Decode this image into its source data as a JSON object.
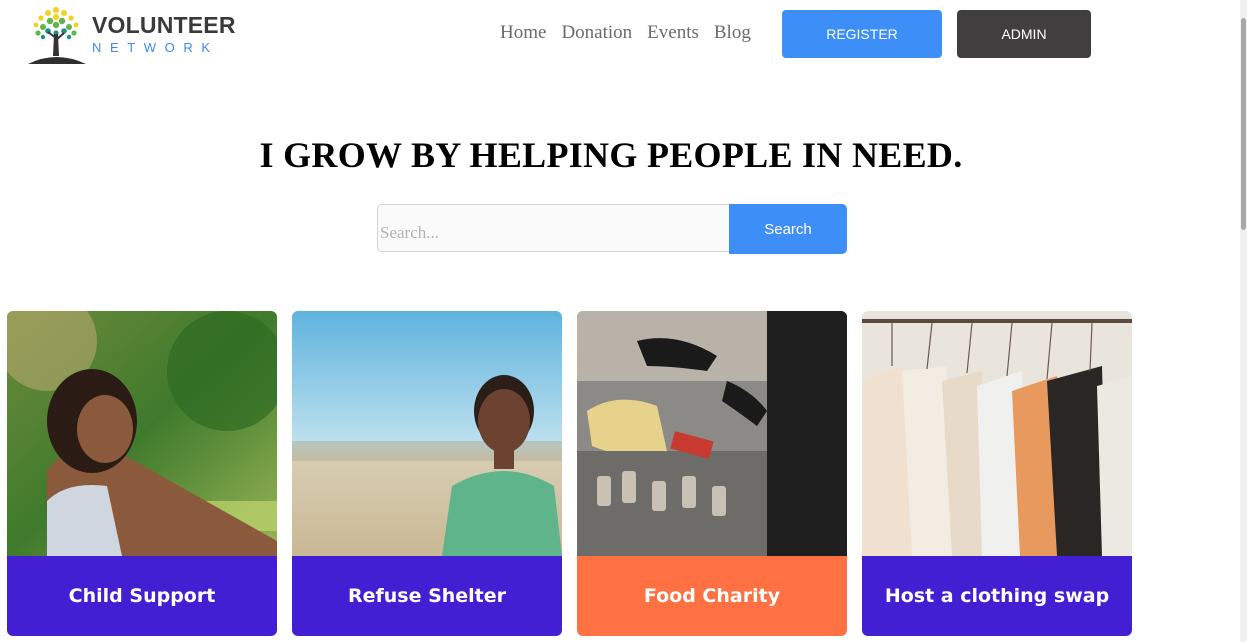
{
  "brand": {
    "name_top": "VOLUNTEER",
    "name_bottom": "NETWORK"
  },
  "nav": {
    "items": [
      "Home",
      "Donation",
      "Events",
      "Blog"
    ]
  },
  "header_buttons": {
    "register": "REGISTER",
    "admin": "ADMIN"
  },
  "hero": {
    "title": "I GROW BY HELPING PEOPLE IN NEED.",
    "search_placeholder": "Search...",
    "search_button": "Search"
  },
  "cards": [
    {
      "title": "Child Support",
      "color": "#421fd2"
    },
    {
      "title": "Refuse Shelter",
      "color": "#421fd2"
    },
    {
      "title": "Food Charity",
      "color": "#ff7143"
    },
    {
      "title": "Host a clothing swap",
      "color": "#421fd2"
    }
  ],
  "colors": {
    "accent": "#3d8ff7",
    "dark_button": "#403e3f",
    "card_purple": "#421fd2",
    "card_orange": "#ff7143"
  }
}
